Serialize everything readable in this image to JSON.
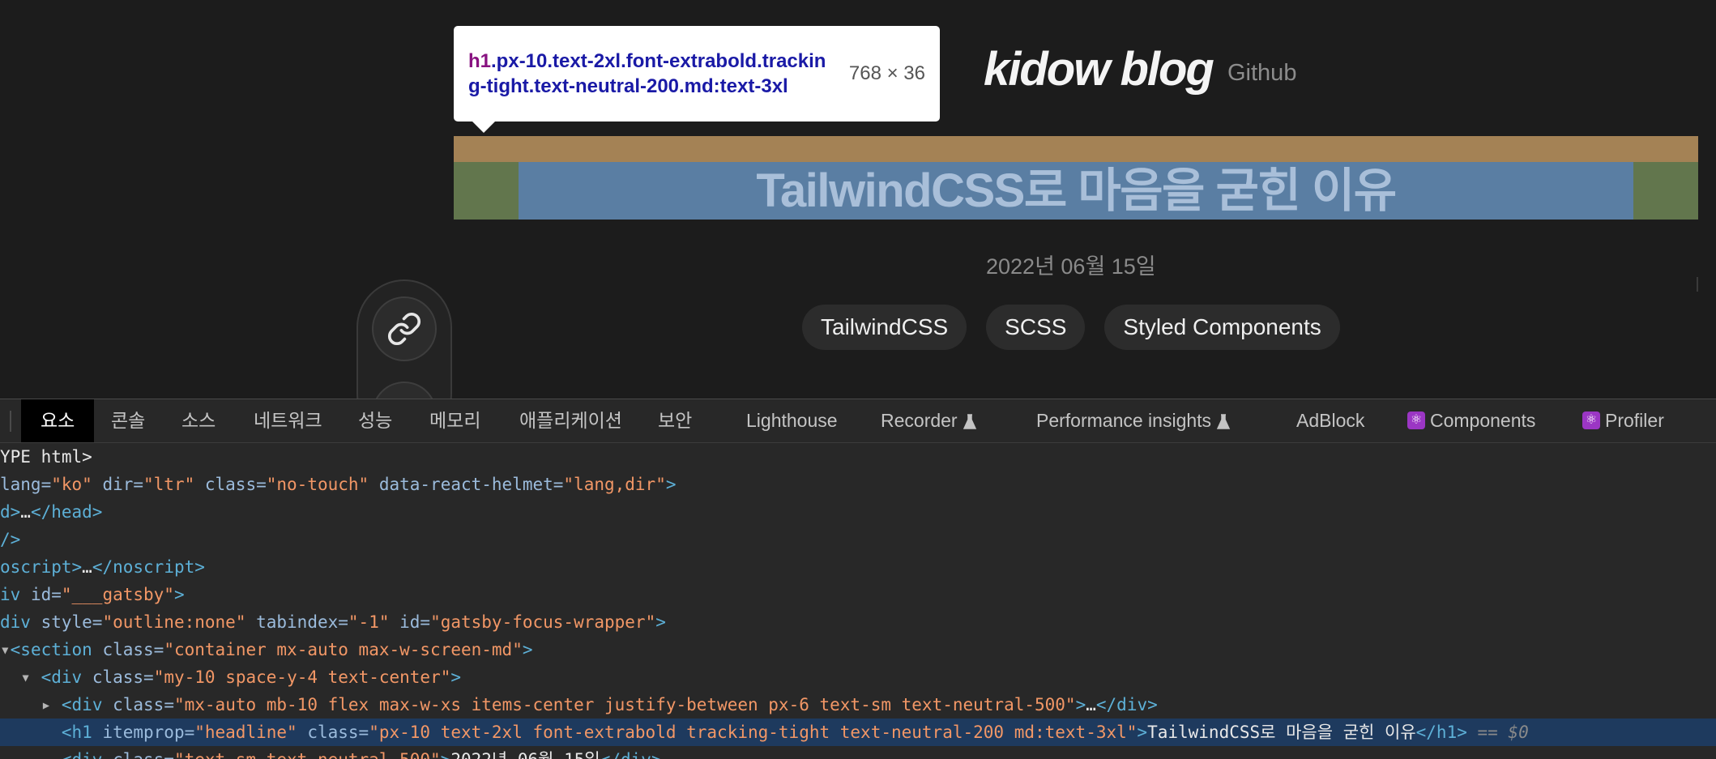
{
  "site": {
    "title": "kidow blog",
    "nav_github": "Github"
  },
  "tooltip": {
    "tag": "h1",
    "classes": ".px-10.text-2xl.font-extrabold.tracking-tight.text-neutral-200.md:text-3xl",
    "size": "768 × 36"
  },
  "post": {
    "headline": "TailwindCSS로 마음을 굳힌 이유",
    "date": "2022년 06월 15일",
    "tags": [
      "TailwindCSS",
      "SCSS",
      "Styled Components"
    ]
  },
  "share": {
    "icons": [
      "link-icon"
    ]
  },
  "devtools": {
    "tabs": [
      "요소",
      "콘솔",
      "소스",
      "네트워크",
      "성능",
      "메모리",
      "애플리케이션",
      "보안",
      "Lighthouse",
      "Recorder",
      "Performance insights",
      "AdBlock",
      "Components",
      "Profiler"
    ],
    "active_tab": "요소",
    "lines": [
      {
        "pre": "",
        "tag_open": "YPE html>",
        "attrs": [],
        "after": ""
      },
      {
        "pre": "",
        "tag_open": "lang=",
        "attrs": [],
        "after": ""
      },
      {
        "pre": "",
        "tag_open": "d>",
        "attrs": [],
        "after": "…</head>"
      },
      {
        "pre": "",
        "tag_open": "/>",
        "attrs": [],
        "after": ""
      },
      {
        "pre": "",
        "tag_open": "oscript>",
        "attrs": [],
        "after": "…</noscript>"
      },
      {
        "pre": "",
        "tag_open": "iv",
        "attrs": [],
        "after": ""
      }
    ],
    "tree": {
      "l1": "YPE html>",
      "l2_a": "lang=",
      "l2_b": "\"ko\"",
      "l2_c": " dir=",
      "l2_d": "\"ltr\"",
      "l2_e": " class=",
      "l2_f": "\"no-touch\"",
      "l2_g": " data-react-helmet=",
      "l2_h": "\"lang,dir\"",
      "l2_i": ">",
      "l3_a": "d>",
      "l3_b": "…",
      "l3_c": "</head>",
      "l4": "/>",
      "l5_a": "oscript>",
      "l5_b": "…",
      "l5_c": "</noscript>",
      "l6_a": "iv",
      "l6_b": " id=",
      "l6_c": "\"___gatsby\"",
      "l6_d": ">",
      "l7_a": "div",
      "l7_b": " style=",
      "l7_c": "\"outline:none\"",
      "l7_d": " tabindex=",
      "l7_e": "\"-1\"",
      "l7_f": " id=",
      "l7_g": "\"gatsby-focus-wrapper\"",
      "l7_h": ">",
      "l8_a": "<section",
      "l8_b": " class=",
      "l8_c": "\"container mx-auto max-w-screen-md\"",
      "l8_d": ">",
      "l9_a": "<div",
      "l9_b": " class=",
      "l9_c": "\"my-10 space-y-4 text-center\"",
      "l9_d": ">",
      "l10_a": "<div",
      "l10_b": " class=",
      "l10_c": "\"mx-auto mb-10 flex max-w-xs items-center justify-between px-6 text-sm text-neutral-500\"",
      "l10_d": ">",
      "l10_e": "…",
      "l10_f": "</div>",
      "l11_a": "<h1",
      "l11_b": " itemprop=",
      "l11_c": "\"headline\"",
      "l11_d": " class=",
      "l11_e": "\"px-10 text-2xl font-extrabold tracking-tight text-neutral-200 md:text-3xl\"",
      "l11_f": ">",
      "l11_g": "TailwindCSS로 마음을 굳힌 이유",
      "l11_h": "</h1>",
      "l11_i": " == $0",
      "l12_a": "<div",
      "l12_b": " class=",
      "l12_c": "\"text-sm text-neutral-500\"",
      "l12_d": ">",
      "l12_e": "2022년 06월 15일",
      "l12_f": "</div>"
    }
  },
  "colors": {
    "accent_selection": "#1e3a5e",
    "highlight_content": "#5a7ea3",
    "highlight_padding": "#62764d",
    "highlight_margin": "#a48255"
  }
}
